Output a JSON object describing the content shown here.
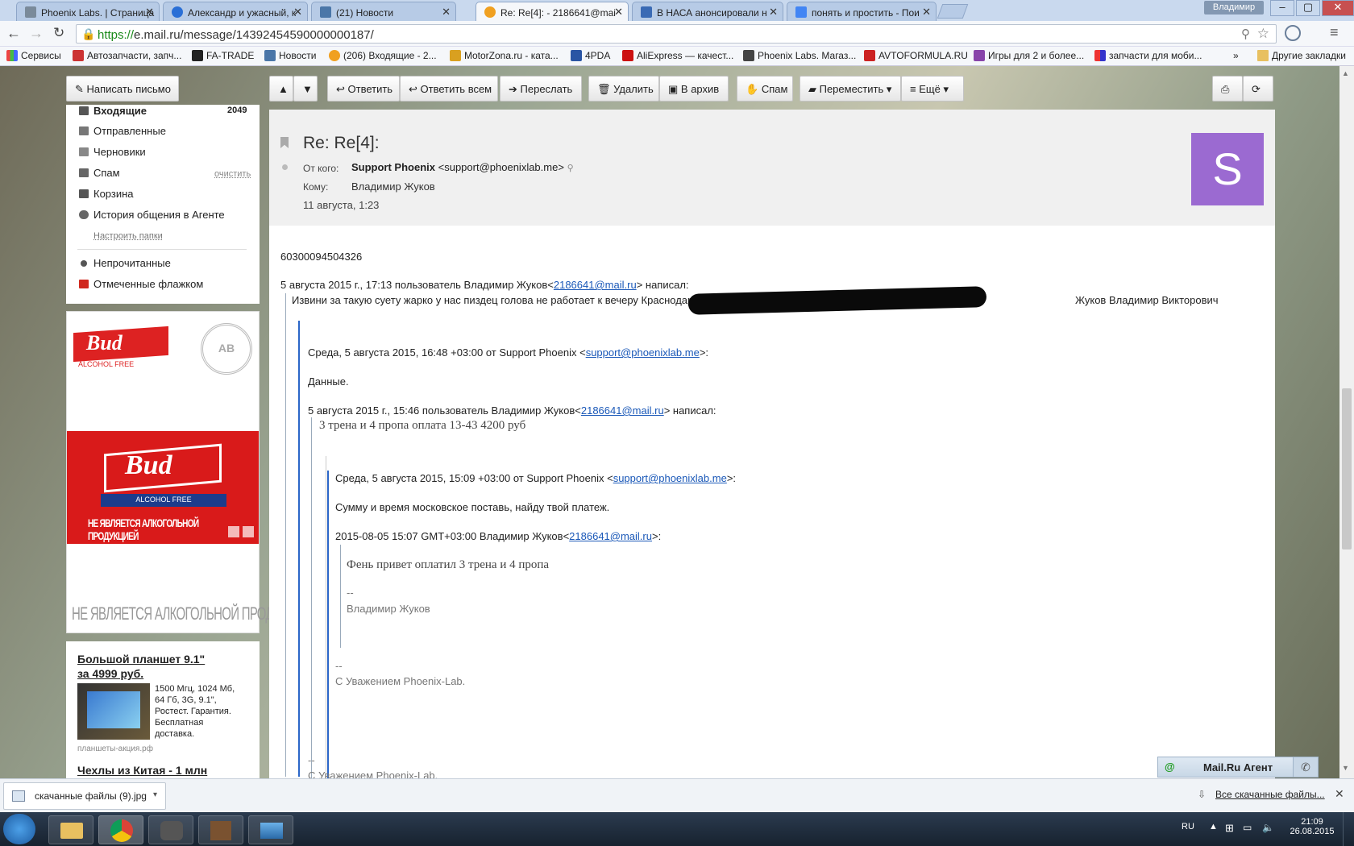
{
  "tabs": [
    {
      "title": "Phoenix Labs. | Страница"
    },
    {
      "title": "Александр и ужасный, к"
    },
    {
      "title": "(21) Новости"
    },
    {
      "title": "Re: Re[4]: - 2186641@mai"
    },
    {
      "title": "В НАСА анонсировали н"
    },
    {
      "title": "понять и простить - Пои"
    }
  ],
  "user_badge": "Владимир",
  "address": {
    "scheme": "https://",
    "rest": "e.mail.ru/message/14392454590000000187/"
  },
  "bookmarks": [
    "Сервисы",
    "Автозапчасти, запч...",
    "FA-TRADE",
    "Новости",
    "(206) Входящие - 2...",
    "MotorZona.ru - ката...",
    "4PDA",
    "AliExpress — качест...",
    "Phoenix Labs. Магаз...",
    "AVTOFORMULA.RU",
    "Игры для 2 и более...",
    "запчасти для моби..."
  ],
  "bookmarks_more": "»",
  "bookmarks_other": "Другие закладки",
  "mail_toolbar": {
    "compose": "Написать письмо",
    "reply": "Ответить",
    "reply_all": "Ответить всем",
    "forward": "Переслать",
    "delete": "Удалить",
    "archive": "В архив",
    "spam": "Спам",
    "move": "Переместить",
    "more": "Ещё"
  },
  "folders": {
    "inbox": "Входящие",
    "inbox_count": "2049",
    "sent": "Отправленные",
    "drafts": "Черновики",
    "spam": "Спам",
    "spam_clear": "очистить",
    "trash": "Корзина",
    "agent_history": "История общения в Агенте",
    "configure": "Настроить папки",
    "unread": "Непрочитанные",
    "flagged": "Отмеченные флажком"
  },
  "ad_banner": {
    "brand": "Bud",
    "subtitle": "ALCOHOL FREE",
    "seal": "AB",
    "disclaimer": "НЕ ЯВЛЯЕТСЯ АЛКОГОЛЬНОЙ ПРОДУКЦИЕЙ",
    "footer": "НЕ ЯВЛЯЕТСЯ АЛКОГОЛЬНОЙ ПРОДУКЦИЕЙ"
  },
  "ad_text": {
    "title_line1": "Большой планшет 9.1\"",
    "title_line2": "за 4999 руб.",
    "desc": [
      "1500 Мгц, 1024 Мб,",
      "64 Гб, 3G, 9.1\",",
      "Ростест. Гарантия.",
      "Бесплатная",
      "доставка."
    ],
    "domain": "планшеты-акция.рф",
    "next_title": "Чехлы из Китая - 1 млн"
  },
  "message": {
    "subject": "Re: Re[4]:",
    "from_label": "От кого:",
    "from_name": "Support Phoenix",
    "from_email": "<support@phoenixlab.me>",
    "to_label": "Кому:",
    "to_name": "Владимир Жуков",
    "date": "11 августа, 1:23",
    "avatar_letter": "S",
    "avatar_color": "#9b6ad1",
    "body": {
      "number": "60300094504326",
      "q1_header_pre": "5 августа 2015 г., 17:13 пользователь Владимир Жуков<",
      "q1_header_link": "2186641@mail.ru",
      "q1_header_post": "> написал:",
      "q1_text": "Извини за такую суету жарко у нас пиздец голова не работает к вечеру Краснодар",
      "q1_text_tail": "Жуков Владимир Викторович",
      "q2_header_pre": "Среда, 5 августа 2015, 16:48 +03:00 от Support Phoenix <",
      "q2_header_link": "support@phoenixlab.me",
      "q2_header_post": ">:",
      "q2_text": "Данные.",
      "q3_header_pre": "5 августа 2015 г., 15:46 пользователь Владимир Жуков<",
      "q3_header_link": "2186641@mail.ru",
      "q3_header_post": "> написал:",
      "q3_text": "3 трена и 4 пропа оплата 13-43 4200 руб",
      "q4_header_pre": "Среда, 5 августа 2015, 15:09 +03:00 от Support Phoenix <",
      "q4_header_link": "support@phoenixlab.me",
      "q4_header_post": ">:",
      "q4_text": "Сумму и время московское поставь, найду твой платеж.",
      "q5_header_pre": "2015-08-05 15:07 GMT+03:00 Владимир Жуков<",
      "q5_header_link": "2186641@mail.ru",
      "q5_header_post": ">:",
      "q5_text": "Фень привет оплатил 3 трена и 4 пропа",
      "q5_sig_dash": "--",
      "q5_sig": "Владимир Жуков",
      "q4_sig_dash": "--",
      "q4_sig": "С Уважением Phoenix-Lab.",
      "bottom_dash": "--",
      "bottom_sig": "С Уважением Phoenix-Lab."
    }
  },
  "agent_bar": {
    "label": "Mail.Ru Агент"
  },
  "download": {
    "file": "скачанные файлы (9).jpg",
    "all": "Все скачанные файлы..."
  },
  "taskbar": {
    "lang": "RU",
    "time": "21:09",
    "date": "26.08.2015"
  }
}
